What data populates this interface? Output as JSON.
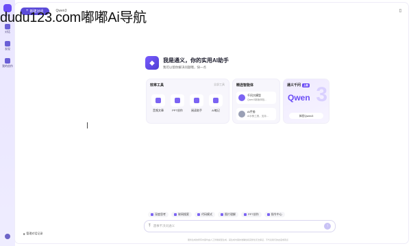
{
  "rail": {
    "logo_label": "通义",
    "items": [
      {
        "icon": "chat-icon",
        "label": "对话"
      },
      {
        "icon": "grid-icon",
        "label": "发现"
      },
      {
        "icon": "folder-icon",
        "label": "我的创作"
      }
    ]
  },
  "topbar": {
    "new_chat": "新建对话",
    "model": "Qwen3"
  },
  "watermark": "dudu123.com嘟嘟Ai导航",
  "hero": {
    "title": "我是通义，你的实用AI助手",
    "subtitle": "我可以帮你解决问题哦，快一点"
  },
  "tools": {
    "title": "效率工具",
    "more": "全部工具",
    "items": [
      {
        "label": "音频文章"
      },
      {
        "label": "PPT创作"
      },
      {
        "label": "阅读助手"
      },
      {
        "label": "AI笔记"
      }
    ]
  },
  "agents": {
    "title": "精选智能体",
    "items": [
      {
        "name": "千问大模型",
        "desc": "Qwen3新版体验..."
      },
      {
        "name": "AI手势",
        "desc": "AI手势工具，支持..."
      }
    ]
  },
  "qwen": {
    "title": "通义千问",
    "badge": "上新",
    "brand": "Qwen",
    "big3": "3",
    "button": "体验Qwen3"
  },
  "pills": [
    {
      "label": "深度思考"
    },
    {
      "label": "联网搜索"
    },
    {
      "label": "代码模式"
    },
    {
      "label": "图片理解"
    },
    {
      "label": "PPT创作"
    },
    {
      "label": "指令中心"
    }
  ],
  "input": {
    "placeholder": "遇事不决问通义"
  },
  "disclaimer": "服务生成的所有内容均由人工智能模型生成，其生成内容的准确性和完整性无法保证，不代表我们的态度或观点",
  "manage": "管理对话记录"
}
